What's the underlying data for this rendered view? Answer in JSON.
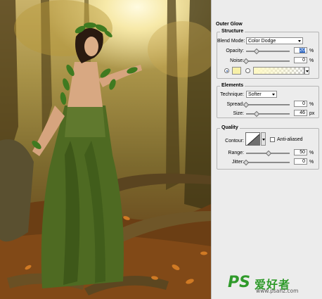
{
  "panel": {
    "title": "Outer Glow",
    "structure": {
      "title": "Structure",
      "blend_mode_label": "Blend Mode:",
      "blend_mode_value": "Color Dodge",
      "opacity_label": "Opacity:",
      "opacity_value": "20",
      "opacity_unit": "%",
      "noise_label": "Noise:",
      "noise_value": "0",
      "noise_unit": "%",
      "color_swatch": "#f7f0a8",
      "gradient_from": "#fff9c4"
    },
    "elements": {
      "title": "Elements",
      "technique_label": "Technique:",
      "technique_value": "Softer",
      "spread_label": "Spread:",
      "spread_value": "0",
      "spread_unit": "%",
      "size_label": "Size:",
      "size_value": "46",
      "size_unit": "px"
    },
    "quality": {
      "title": "Quality",
      "contour_label": "Contour:",
      "anti_aliased_label": "Anti-aliased",
      "range_label": "Range:",
      "range_value": "50",
      "range_unit": "%",
      "jitter_label": "Jitter:",
      "jitter_value": "0",
      "jitter_unit": "%"
    }
  },
  "watermark": {
    "logo": "PS",
    "name": "爱好者",
    "url": "www.psahz.com"
  }
}
